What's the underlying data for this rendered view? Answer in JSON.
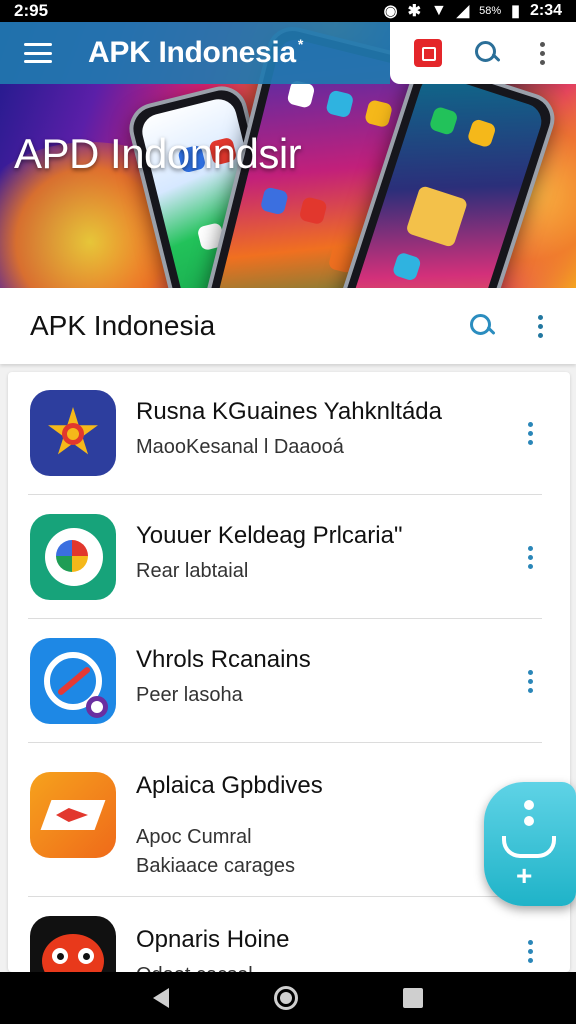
{
  "status_bar": {
    "time_left": "2:95",
    "battery_text": "58%",
    "time_right": "2:34"
  },
  "app_bar": {
    "title": "APK Indonesia",
    "title_mark": "*"
  },
  "hero": {
    "title": "APD Indonndsir"
  },
  "section": {
    "title": "APK Indonesia"
  },
  "apps": [
    {
      "title": "Rusna KGuaines Yahknltáda",
      "subtitle": "MaooKesanal l Daaooá",
      "icon": "star-icon"
    },
    {
      "title": "Youuer Keldeag Prlcaria\"",
      "subtitle": "Rear labtaial",
      "icon": "swirl-icon"
    },
    {
      "title": "Vhrols Rcanains",
      "subtitle": "Peer lasoha",
      "icon": "compass-icon"
    },
    {
      "title": "Aplaica Gpbdives",
      "subtitle": "Apoc Cumral",
      "subtitle2": "Bakiaace carages",
      "icon": "arrow-icon"
    },
    {
      "title": "Opnaris Hoine",
      "subtitle": "Odaet cacsel",
      "icon": "owl-icon"
    }
  ],
  "colors": {
    "app_bar_blue": "#2178af",
    "accent": "#2a86b8",
    "fab": "#1fb3c8"
  }
}
